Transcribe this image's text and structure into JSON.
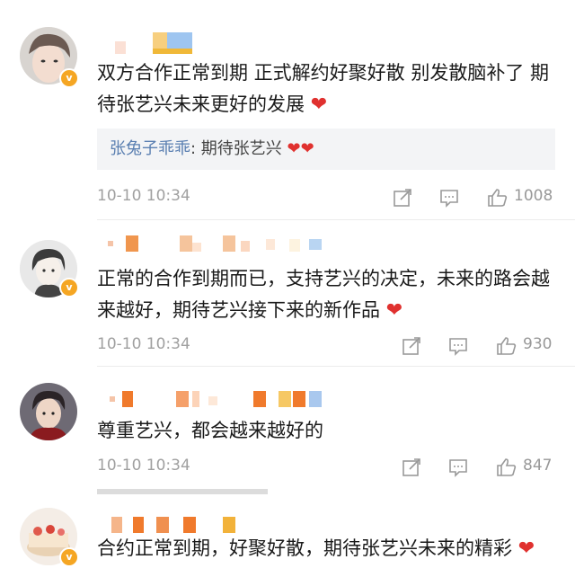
{
  "comments": [
    {
      "text": "双方合作正常到期 正式解约好聚好散 别发散脑补了 期待张艺兴未来更好的发展",
      "reply": {
        "name": "张兔子乖乖",
        "sep": ":",
        "text": " 期待张艺兴"
      },
      "time": "10-10 10:34",
      "likes": "1008"
    },
    {
      "text": "正常的合作到期而已，支持艺兴的决定，未来的路会越来越好，期待艺兴接下来的新作品",
      "time": "10-10 10:34",
      "likes": "930"
    },
    {
      "text": "尊重艺兴，都会越来越好的",
      "time": "10-10 10:34",
      "likes": "847"
    },
    {
      "text": "合约正常到期，好聚好散，期待张艺兴未来的精彩"
    }
  ],
  "icons": {
    "share": "share-icon",
    "comment": "comment-icon",
    "like": "thumbs-up-icon",
    "heart": "heart-emoji-icon",
    "verified": "verified-badge-icon"
  },
  "badge_letter": "v",
  "heart_glyph": "❤",
  "colors": {
    "heart": "#e0312f",
    "reply_name": "#5a7fb1",
    "verified_badge": "#f5a623",
    "meta_text": "#a0a0a0"
  }
}
